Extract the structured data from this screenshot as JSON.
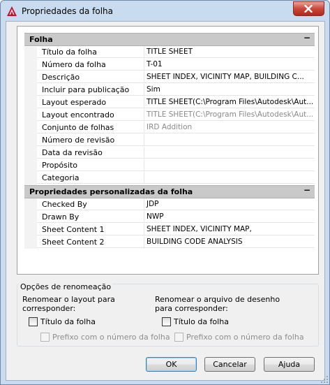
{
  "window": {
    "title": "Propriedades da folha"
  },
  "grid": {
    "categories": [
      {
        "label": "Folha",
        "toggle": "−",
        "rows": [
          {
            "name": "Título da folha",
            "value": "TITLE SHEET"
          },
          {
            "name": "Número da folha",
            "value": "T-01"
          },
          {
            "name": "Descrição",
            "value": "SHEET INDEX, VICINITY MAP, BUILDING C..."
          },
          {
            "name": "Incluir para publicação",
            "value": "Sim"
          },
          {
            "name": "Layout esperado",
            "value": "TITLE SHEET(C:\\Program Files\\Autodesk\\Aut..."
          },
          {
            "name": "Layout encontrado",
            "value": "TITLE SHEET(C:\\Program Files\\Autodesk\\Aut..."
          },
          {
            "name": "Conjunto de folhas",
            "value": "IRD Addition"
          },
          {
            "name": "Número de revisão",
            "value": ""
          },
          {
            "name": "Data da revisão",
            "value": ""
          },
          {
            "name": "Propósito",
            "value": ""
          },
          {
            "name": "Categoria",
            "value": ""
          }
        ]
      },
      {
        "label": "Propriedades personalizadas da folha",
        "toggle": "−",
        "rows": [
          {
            "name": "Checked By",
            "value": "JDP"
          },
          {
            "name": "Drawn By",
            "value": "NWP"
          },
          {
            "name": "Sheet Content 1",
            "value": "SHEET INDEX, VICINITY MAP,"
          },
          {
            "name": "Sheet Content 2",
            "value": "BUILDING CODE ANALYSIS"
          }
        ]
      }
    ]
  },
  "rename": {
    "title": "Opções de renomeação",
    "left": {
      "heading_line1": "Renomear o layout para",
      "heading_line2": "corresponder:",
      "title_cb": "Título da folha",
      "prefix_cb": "Prefixo com o número da folha"
    },
    "right": {
      "heading_line1": "Renomear o arquivo de desenho",
      "heading_line2": "para corresponder:",
      "title_cb": "Título da folha",
      "prefix_cb": "Prefixo com o número da folha"
    }
  },
  "buttons": {
    "ok": "OK",
    "cancel": "Cancelar",
    "help": "Ajuda"
  }
}
